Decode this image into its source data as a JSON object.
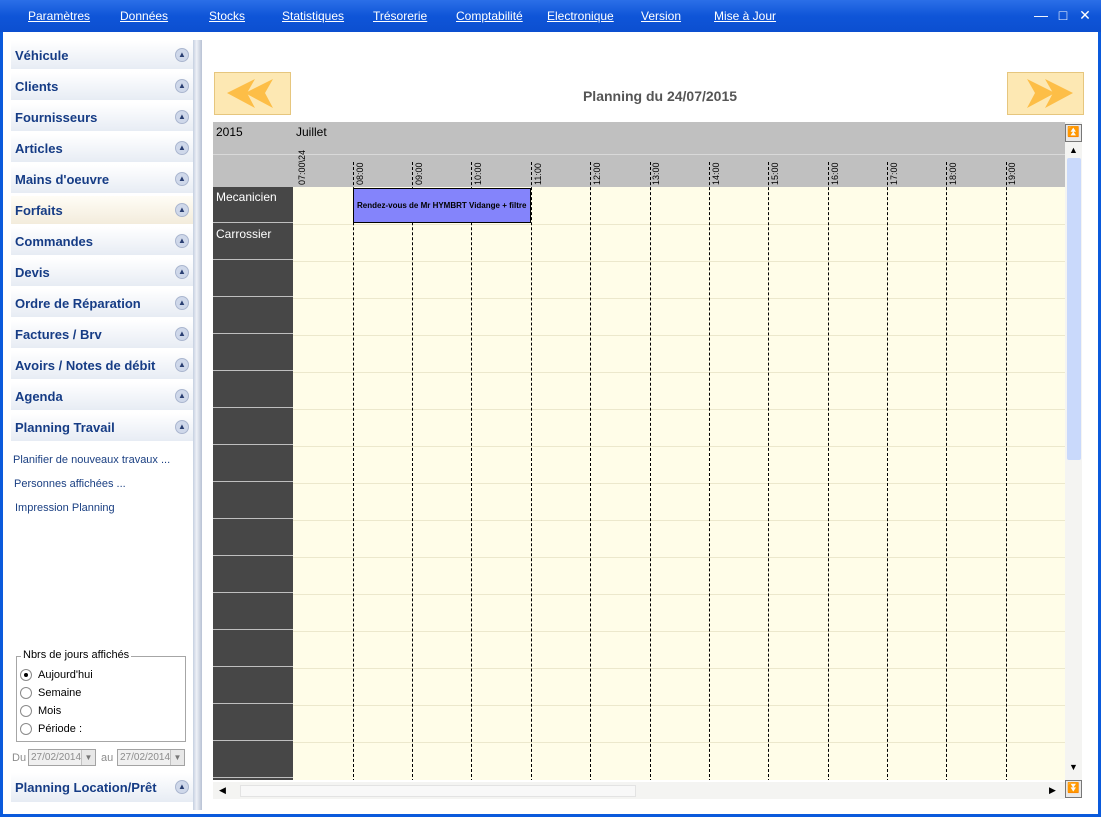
{
  "menu": [
    "Paramètres",
    "Données",
    "Stocks",
    "Statistiques",
    "Trésorerie",
    "Comptabilité",
    "Electronique",
    "Version",
    "Mise à Jour"
  ],
  "window_controls": {
    "minimize": "—",
    "maximize": "□",
    "close": "✕"
  },
  "sidebar": {
    "items": [
      {
        "label": "Véhicule",
        "active": false
      },
      {
        "label": "Clients",
        "active": false
      },
      {
        "label": "Fournisseurs",
        "active": false
      },
      {
        "label": "Articles",
        "active": false
      },
      {
        "label": "Mains d'oeuvre",
        "active": false
      },
      {
        "label": "Forfaits",
        "active": true
      },
      {
        "label": "Commandes",
        "active": false
      },
      {
        "label": "Devis",
        "active": false
      },
      {
        "label": "Ordre de Réparation",
        "active": false
      },
      {
        "label": "Factures / Brv",
        "active": false
      },
      {
        "label": "Avoirs / Notes de débit",
        "active": false
      },
      {
        "label": "Agenda",
        "active": false
      },
      {
        "label": "Planning Travail",
        "active": false
      }
    ],
    "sub_links": [
      "Planifier de nouveaux travaux ...",
      "Personnes affichées ...",
      "Impression Planning"
    ],
    "days_group": {
      "title": "Nbrs de jours affichés",
      "options": [
        "Aujourd'hui",
        "Semaine",
        "Mois",
        "Période :"
      ],
      "selected": 0
    },
    "date_from_label": "Du",
    "date_from": "27/02/2014",
    "date_to_label": "au",
    "date_to": "27/02/2014",
    "bottom_item": "Planning Location/Prêt"
  },
  "planning": {
    "title": "Planning du 24/07/2015",
    "year": "2015",
    "month": "Juillet",
    "day": "07:00\\24",
    "hours": [
      "08:00",
      "09:00",
      "10:00",
      "11:00",
      "12:00",
      "13:00",
      "14:00",
      "15:00",
      "16:00",
      "17:00",
      "18:00",
      "19:00"
    ],
    "resources": [
      "Mecanicien",
      "Carrossier"
    ],
    "appointment": {
      "text": "Rendez-vous de Mr HYMBRT Vidange + filtre",
      "resource": "Mecanicien",
      "start": "08:00",
      "end": "11:00",
      "color": "#8484fb"
    }
  },
  "colors": {
    "title_bar": "#0f55d8",
    "grid_bg": "#fffde8",
    "resource_bg": "#474747",
    "header_bg": "#c0c0c0",
    "nav_arrow": "#fdbe47"
  }
}
